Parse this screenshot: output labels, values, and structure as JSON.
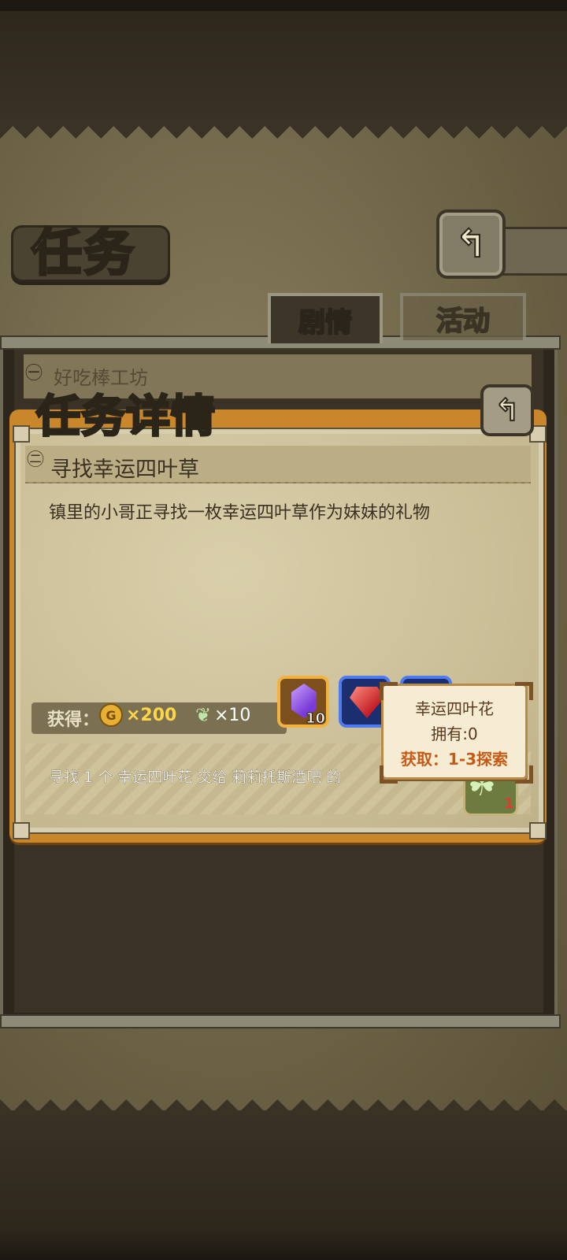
{
  "header": {
    "title": "任务",
    "back_icon": "back-arrow-icon"
  },
  "tabs": [
    {
      "label": "剧情",
      "active": true
    },
    {
      "label": "活动",
      "active": false
    }
  ],
  "list": {
    "items": [
      {
        "label": "好吃棒工坊"
      }
    ]
  },
  "detail": {
    "title": "任务详情",
    "quest_name": "寻找幸运四叶草",
    "description": "镇里的小哥正寻找一枚幸运四叶草作为妹妹的礼物",
    "rewards": {
      "label": "获得：",
      "gold_icon_letter": "G",
      "gold": "×200",
      "feather": "×10",
      "items": [
        {
          "name": "crystal",
          "count": "10",
          "color": "#7a3cd6"
        },
        {
          "name": "ruby",
          "count": "",
          "color": "#c21f26"
        },
        {
          "name": "blue-item",
          "count": "",
          "color": "#4f7bf1"
        }
      ]
    },
    "objective": "寻找 1 个 幸运四叶花 交给 莉莉托斯酒吧 的",
    "required_item": {
      "name": "clover",
      "count": "1"
    }
  },
  "tooltip": {
    "item_name": "幸运四叶花",
    "owned": "拥有:0",
    "source": "获取：1-3探索"
  },
  "colors": {
    "accent_orange": "#c9862b",
    "gold_text": "#ffd54a",
    "source_text": "#c65a16"
  }
}
